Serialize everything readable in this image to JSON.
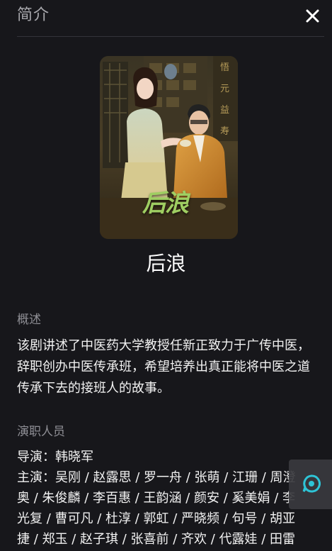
{
  "header": {
    "title": "简介",
    "close_icon": "close-icon"
  },
  "show": {
    "title": "后浪",
    "poster_logo": "后浪"
  },
  "overview": {
    "label": "概述",
    "text": "该剧讲述了中医药大学教授任新正致力于广传中医，辞职创办中医传承班，希望培养出真正能将中医之道传承下去的接班人的故事。"
  },
  "cast": {
    "label": "演职人员",
    "director": "导演：韩晓军",
    "lines": [
      "主演：吴刚 / 赵露思 / 罗一舟 / 张萌 / 江珊 / 周澄",
      "奥 / 朱俊麟 / 李百惠 / 王韵涵 / 颜安 / 奚美娟 / 李",
      "光复 / 曹可凡 / 杜淳 / 郭虹 / 严晓频 / 句号 / 胡亚",
      "捷 / 郑玉 / 赵子琪 / 张喜前 / 齐欢 / 代露娃 / 田雷"
    ]
  },
  "floating_button": {
    "icon": "chat-bubble-icon",
    "accent": "#2ec4d6"
  },
  "colors": {
    "background": "#17171b",
    "muted_text": "#8e8e94",
    "text": "#f2f2f2"
  }
}
